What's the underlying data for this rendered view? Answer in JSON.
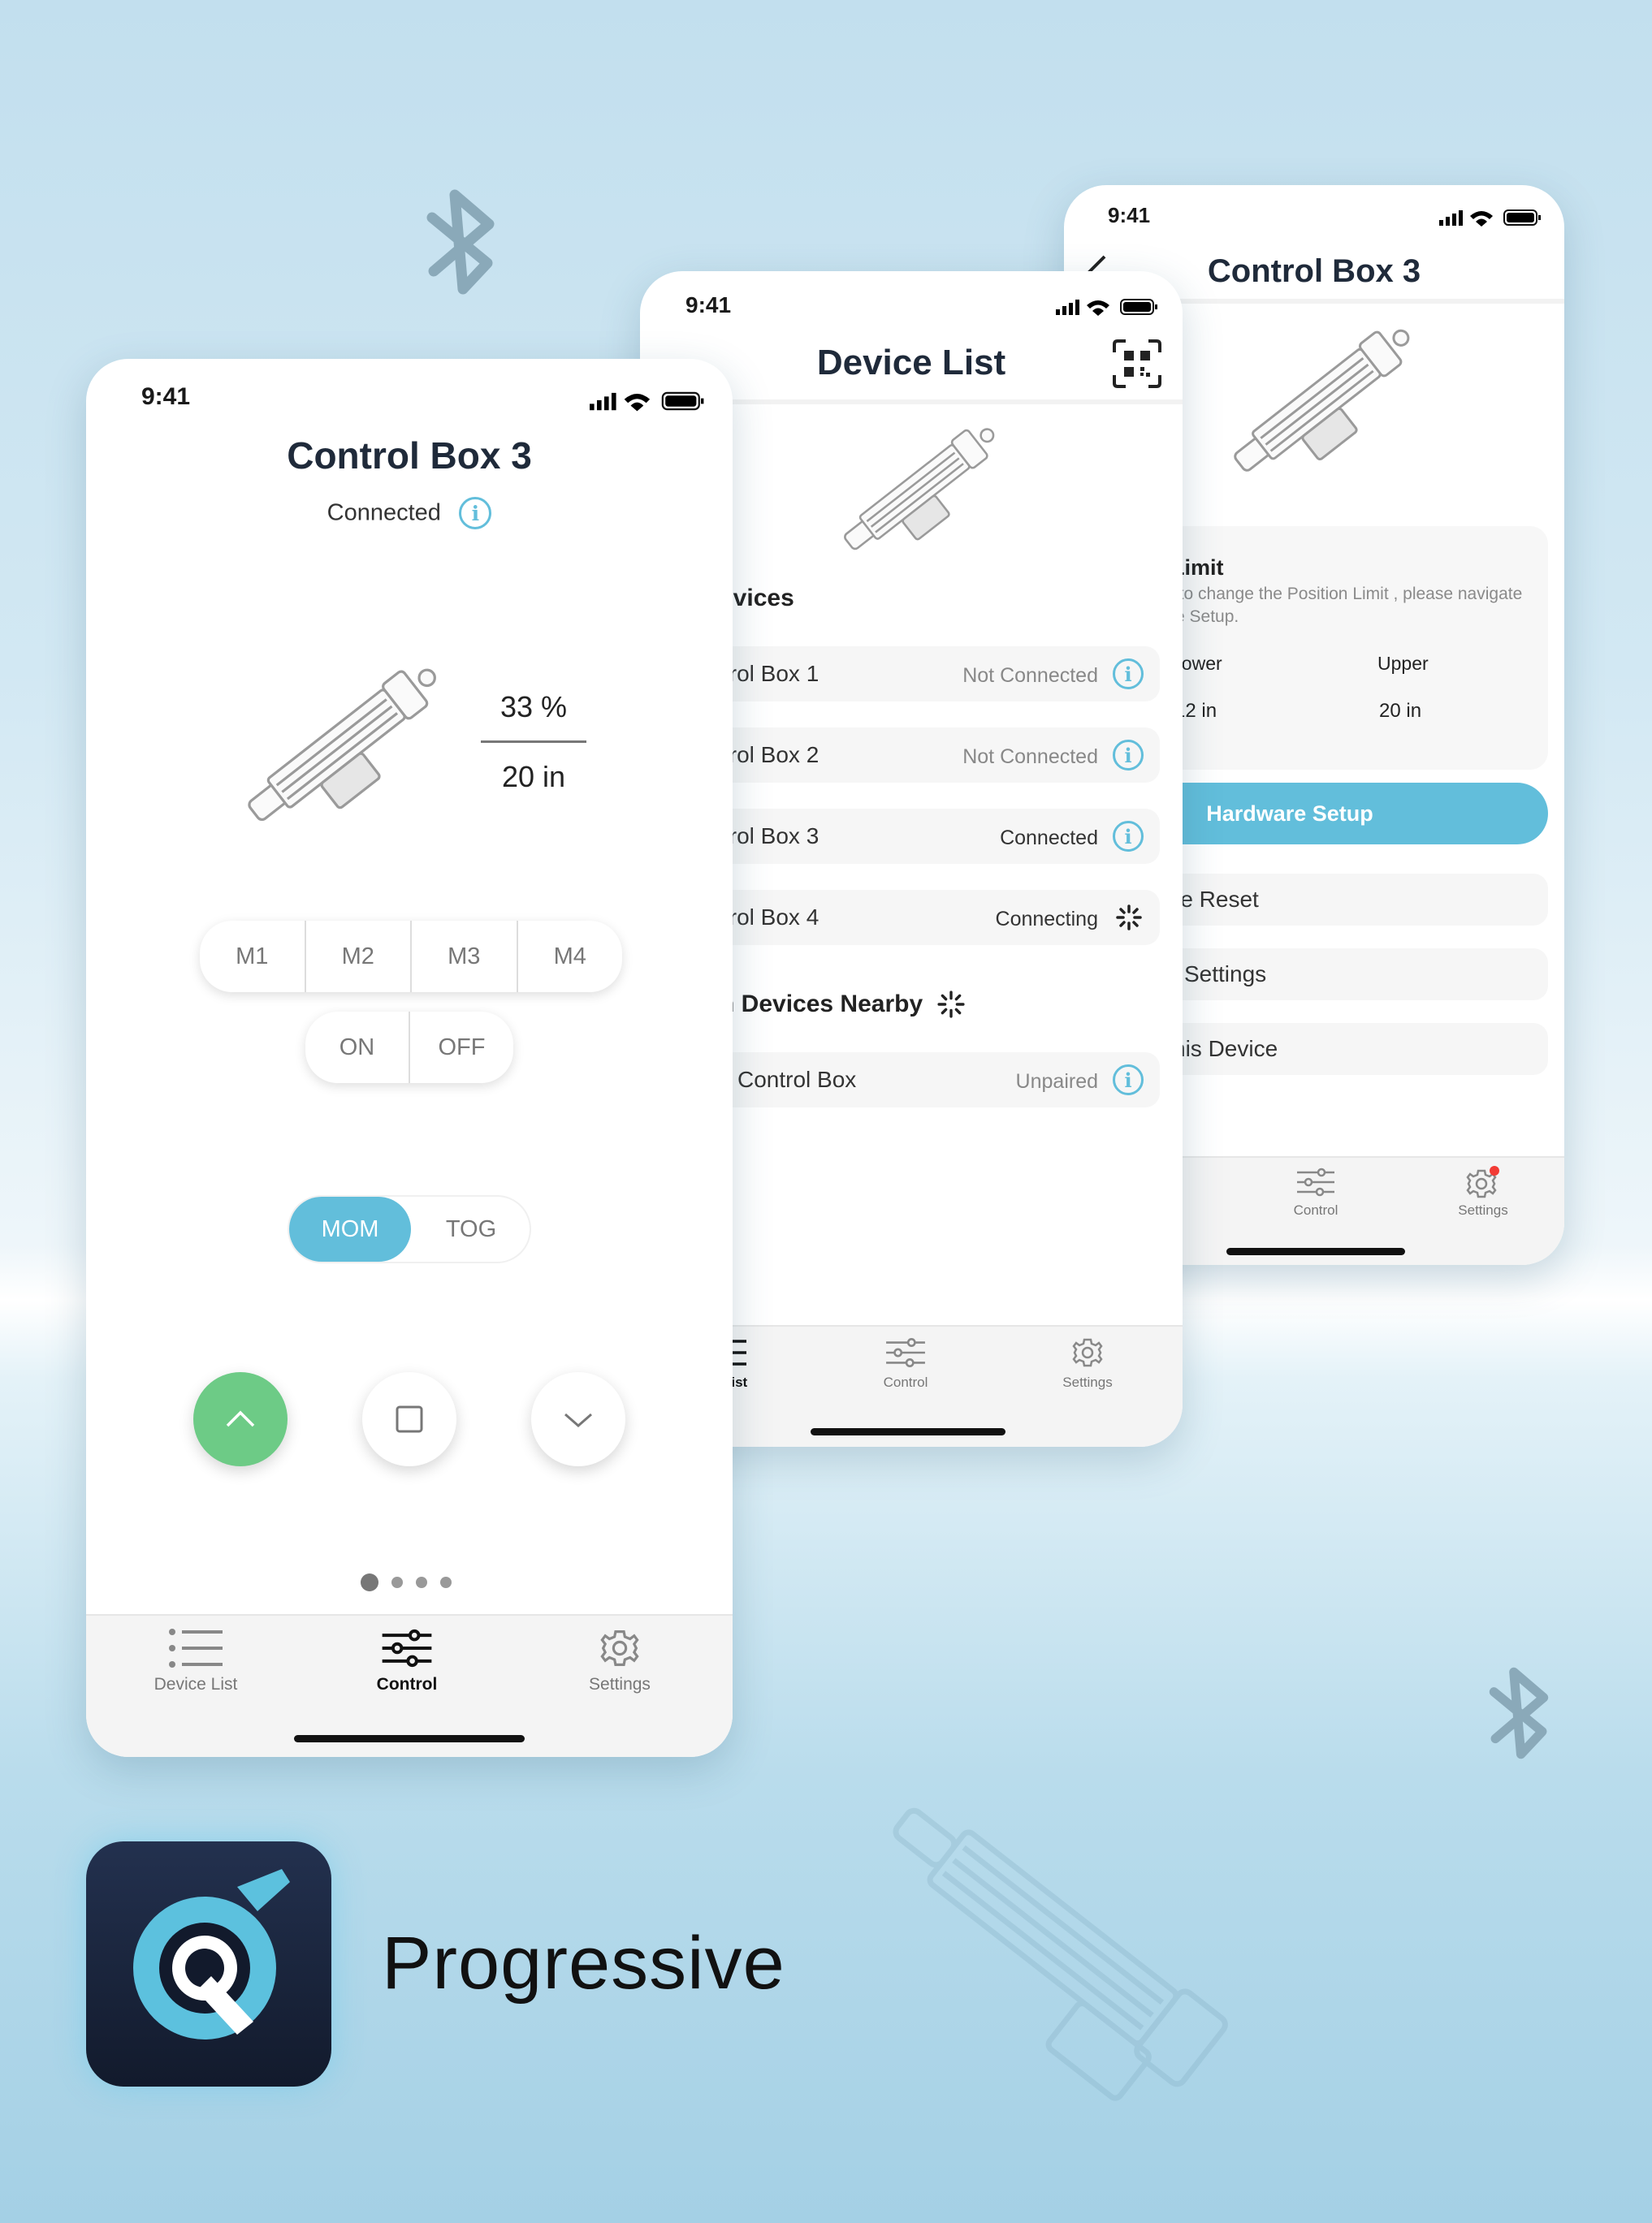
{
  "status_time": "9:41",
  "colors": {
    "accent": "#62bedb",
    "up_button": "#6dcb86",
    "brand_dark": "#1b2741",
    "text_dark": "#1f2a3a"
  },
  "phone_control": {
    "title": "Control Box 3",
    "status": "Connected",
    "percent": "33 %",
    "length": "20 in",
    "memory_buttons": [
      "M1",
      "M2",
      "M3",
      "M4"
    ],
    "on_label": "ON",
    "off_label": "OFF",
    "mode_mom": "MOM",
    "mode_tog": "TOG",
    "page_dots": 4
  },
  "phone_devices": {
    "title": "Device List",
    "section_devices": "evices",
    "devices": [
      {
        "name": "trol Box 1",
        "status": "Not Connected",
        "icon": "info-icon"
      },
      {
        "name": "trol Box 2",
        "status": "Not Connected",
        "icon": "info-icon"
      },
      {
        "name": "trol Box 3",
        "status": "Connected",
        "icon": "info-icon"
      },
      {
        "name": "trol Box 4",
        "status": "Connecting",
        "icon": "spinner-icon"
      }
    ],
    "section_nearby": "h Devices Nearby",
    "nearby": [
      {
        "name": "Control Box",
        "status": "Unpaired",
        "icon": "info-icon"
      }
    ]
  },
  "phone_settings": {
    "title": "Control Box 3",
    "limit_title": "Limit",
    "limit_desc_1": "t to change the Position Limit , please navigate",
    "limit_desc_2": "re Setup.",
    "lower_label": "Lower",
    "upper_label": "Upper",
    "lower_value": "12 in",
    "upper_value": "20 in",
    "hardware_setup": "Hardware Setup",
    "menu": [
      "re Reset",
      "l Settings",
      "his Device"
    ]
  },
  "tabs": {
    "device_list": "Device List",
    "control": "Control",
    "settings": "Settings",
    "device_list_partial": "e List"
  },
  "brand": {
    "name": "Progressive"
  }
}
